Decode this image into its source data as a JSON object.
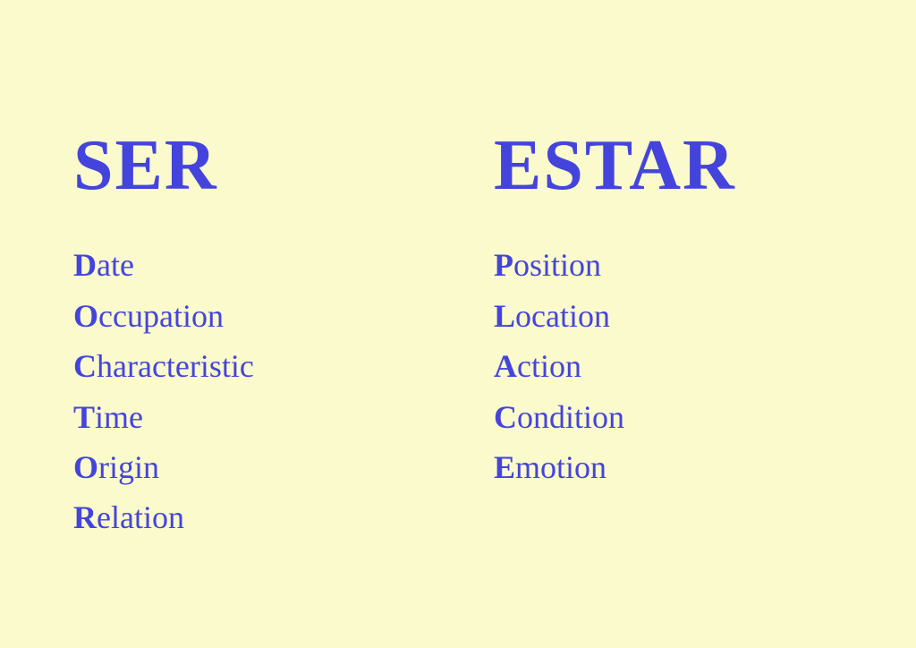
{
  "ser": {
    "title": "SER",
    "acro": [
      {
        "letter": "D",
        "rest": "ate"
      },
      {
        "letter": "O",
        "rest": "ccupation"
      },
      {
        "letter": "C",
        "rest": "haracteristic"
      },
      {
        "letter": "T",
        "rest": "ime"
      },
      {
        "letter": "O",
        "rest": "rigin"
      },
      {
        "letter": "R",
        "rest": "elation"
      }
    ]
  },
  "estar": {
    "title": "ESTAR",
    "acro": [
      {
        "letter": "P",
        "rest": "osition"
      },
      {
        "letter": "L",
        "rest": "ocation"
      },
      {
        "letter": "A",
        "rest": "ction"
      },
      {
        "letter": "C",
        "rest": "ondition"
      },
      {
        "letter": "E",
        "rest": "motion"
      }
    ]
  },
  "colors": {
    "accent": "#4444dd",
    "background": "#fafacc"
  }
}
